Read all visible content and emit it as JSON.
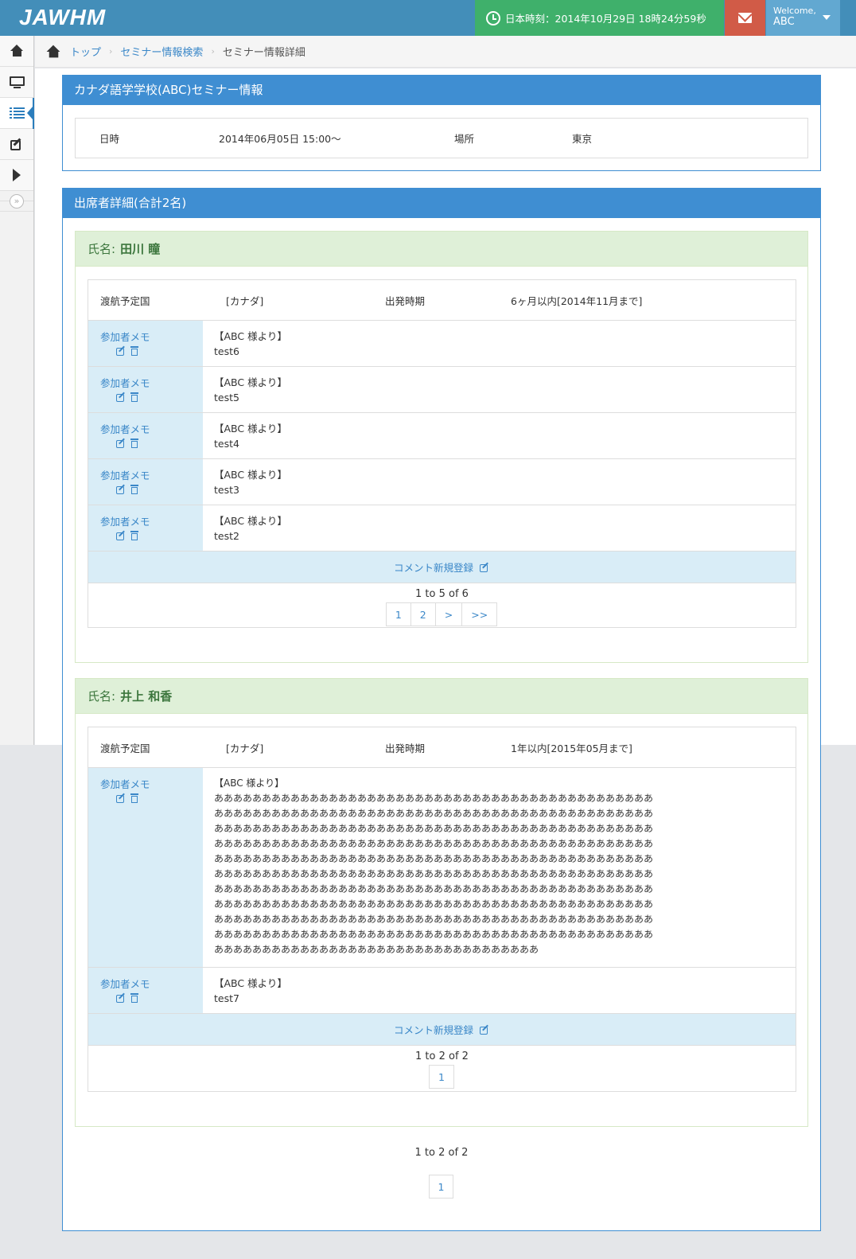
{
  "header": {
    "brand": "JAWHM",
    "clock_text": "日本時刻：2014年10月29日 18時24分59秒",
    "user_welcome": "Welcome,",
    "user_name": "ABC"
  },
  "sidebar": {
    "items": [
      "home-icon",
      "desktop-icon",
      "list-icon",
      "edit-icon",
      "chevron-right-icon"
    ],
    "toggle": "»"
  },
  "breadcrumb": {
    "items": [
      "トップ",
      "セミナー情報検索"
    ],
    "current": "セミナー情報詳細"
  },
  "seminar": {
    "title": "カナダ語学学校(ABC)セミナー情報",
    "date_label": "日時",
    "date_value": "2014年06月05日 15:00～",
    "place_label": "場所",
    "place_value": "東京"
  },
  "attendees": {
    "title": "出席者詳細(合計2名)",
    "name_prefix": "氏名:",
    "country_label": "渡航予定国",
    "depart_label": "出発時期",
    "memo_label": "参加者メモ",
    "memo_from": "【ABC 様より】",
    "comment_label": "コメント新規登録",
    "people": [
      {
        "name": "田川 瞳",
        "country": "[カナダ]",
        "depart": "6ヶ月以内[2014年11月まで]",
        "memos": [
          "test6",
          "test5",
          "test4",
          "test3",
          "test2"
        ],
        "pager_text": "1 to 5 of 6",
        "pages": [
          "1",
          "2",
          ">",
          ">>"
        ]
      },
      {
        "name": "井上 和香",
        "country": "[カナダ]",
        "depart": "1年以内[2015年05月まで]",
        "memos": [
          "ああああああああああああああああああああああああああああああああああああああああああああああ\nああああああああああああああああああああああああああああああああああああああああああああああ\nああああああああああああああああああああああああああああああああああああああああああああああ\nああああああああああああああああああああああああああああああああああああああああああああああ\nああああああああああああああああああああああああああああああああああああああああああああああ\nああああああああああああああああああああああああああああああああああああああああああああああ\nああああああああああああああああああああああああああああああああああああああああああああああ\nああああああああああああああああああああああああああああああああああああああああああああああ\nああああああああああああああああああああああああああああああああああああああああああああああ\nああああああああああああああああああああああああああああああああああああああああああああああ\nああああああああああああああああああああああああああああああああああ",
          "test7"
        ],
        "pager_text": "1 to 2 of 2",
        "pages": [
          "1"
        ]
      }
    ],
    "pager_text": "1 to 2 of 2",
    "pages": [
      "1"
    ]
  }
}
